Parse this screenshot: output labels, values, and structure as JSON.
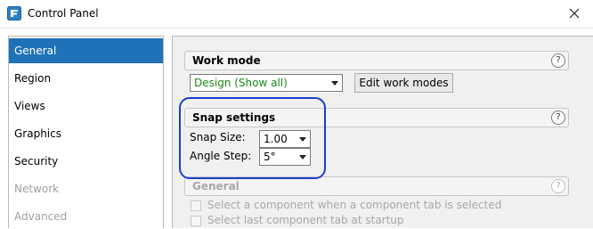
{
  "window": {
    "title": "Control Panel",
    "close_icon": "close-icon",
    "app_icon": "control-panel-app-icon"
  },
  "sidebar": {
    "items": [
      {
        "label": "General",
        "state": "selected"
      },
      {
        "label": "Region",
        "state": "normal"
      },
      {
        "label": "Views",
        "state": "normal"
      },
      {
        "label": "Graphics",
        "state": "normal"
      },
      {
        "label": "Security",
        "state": "normal"
      },
      {
        "label": "Network",
        "state": "disabled"
      },
      {
        "label": "Advanced",
        "state": "disabled"
      }
    ],
    "selected_color": "#1f72b8"
  },
  "work_mode": {
    "title": "Work mode",
    "help": "?",
    "select_value": "Design (Show all)",
    "select_value_color": "#1a8a1a",
    "edit_button": "Edit work modes"
  },
  "snap_settings": {
    "title": "Snap settings",
    "help": "?",
    "snap_size_label": "Snap Size:",
    "snap_size_value": "1.00",
    "angle_step_label": "Angle Step:",
    "angle_step_value": "5°",
    "highlight_color": "#1a3fcc"
  },
  "general": {
    "title": "General",
    "help": "?",
    "options": [
      {
        "label": "Select a component when a component tab is selected",
        "checked": false,
        "enabled": false
      },
      {
        "label": "Select last component tab at startup",
        "checked": false,
        "enabled": false
      }
    ]
  }
}
